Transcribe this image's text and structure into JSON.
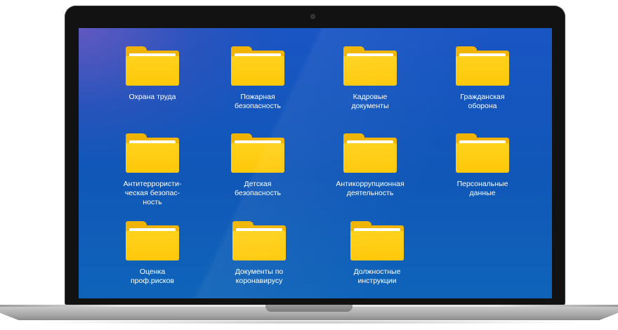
{
  "desktop": {
    "folders": [
      {
        "label": "Охрана труда"
      },
      {
        "label": "Пожарная\nбезопасность"
      },
      {
        "label": "Кадровые\nдокументы"
      },
      {
        "label": "Гражданская\nоборона"
      },
      {
        "label": "Антитеррористи-\nческая безопас-\nность"
      },
      {
        "label": "Детская\nбезопасность"
      },
      {
        "label": "Антикоррупционная\nдеятельность"
      },
      {
        "label": "Персональные\nданные"
      },
      {
        "label": "Оценка\nпроф.рисков"
      },
      {
        "label": "Документы по\nкоронавирусу"
      },
      {
        "label": "Должностные\nинструкции"
      }
    ]
  },
  "colors": {
    "folder_front": "#ffc80a",
    "folder_back": "#f0b400",
    "desktop_background": "#1057b8",
    "bezel": "#121212"
  },
  "icons": {
    "folder": "folder-icon",
    "camera": "camera-icon"
  }
}
